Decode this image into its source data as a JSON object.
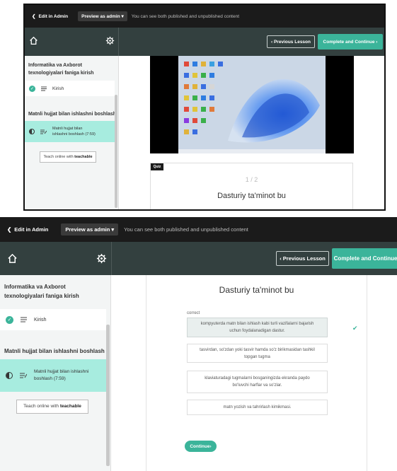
{
  "topbar": {
    "back_label": "Edit in Admin",
    "preview_label": "Preview as admin",
    "note": "You can see both published and unpublished content"
  },
  "nav": {
    "prev_label": "Previous Lesson",
    "complete_label": "Complete and Continue"
  },
  "sidebar": {
    "course_title": "Informatika va Axborot texnologiyalari faniga kirish",
    "item1_label": "Kirish",
    "section_title": "Matnli hujjat bilan ishlashni boshlash",
    "active_label": "Matnli hujjat bilan ishlashni boshlash (7:59)",
    "teach_prefix": "Teach online with",
    "teach_brand": "teachable"
  },
  "quiz": {
    "tag": "Quiz",
    "count": "1 / 2",
    "question": "Dasturiy ta'minot bu",
    "correct_label": "correct",
    "answers": [
      "kompyuterda matn bilan ishlash kabi turli vazifalarni bajarish uchun foydalanadigan dastur.",
      "tasvirdan, so'zdan yoki tasvir hamda so'z birikmasidan tashkil topgan tugma",
      "klaviaturadagi tugmalarni bosganingizda ekranda paydo bo'luvchi harflar va so'zlar.",
      "matn yozish va tahrirlash kimikmasi."
    ],
    "continue_label": "Continue"
  },
  "colors": {
    "accent": "#3bb49a",
    "active_row": "#a7ecdf",
    "dark_bar": "#1b1b1b",
    "nav_bar": "#33403f"
  }
}
